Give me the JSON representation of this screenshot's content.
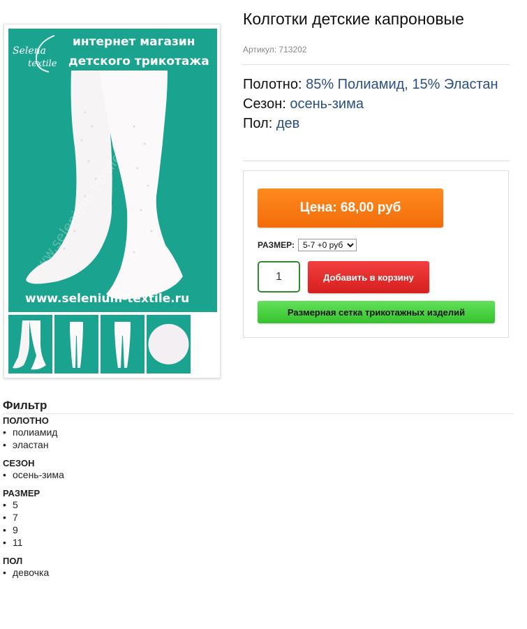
{
  "product": {
    "title": "Колготки детские капроновые",
    "sku_label": "Артикул:",
    "sku_value": "713202",
    "image_banner_line1": "интернет магазин",
    "image_banner_line2": "детского трикотажа",
    "image_logo_line1": "Selena",
    "image_logo_line2": "textile",
    "image_site": "www.selenium-textile.ru",
    "properties": [
      {
        "label": "Полотно:",
        "value": "85% Полиамид, 15% Эластан"
      },
      {
        "label": "Сезон:",
        "value": "осень-зима"
      },
      {
        "label": "Пол:",
        "value": "дев"
      }
    ]
  },
  "buy": {
    "price_label": "Цена: 68,00 руб",
    "size_label": "РАЗМЕР:",
    "size_selected": "5-7 +0 руб",
    "quantity": "1",
    "add_to_cart": "Добавить в корзину",
    "size_chart": "Размерная сетка трикотажных изделий"
  },
  "filter": {
    "title": "Фильтр",
    "groups": [
      {
        "title": "ПОЛОТНО",
        "items": [
          "полиамид",
          "эластан"
        ]
      },
      {
        "title": "СЕЗОН",
        "items": [
          "осень-зима"
        ]
      },
      {
        "title": "РАЗМЕР",
        "items": [
          "5",
          "7",
          "9",
          "11"
        ]
      },
      {
        "title": "ПОЛ",
        "items": [
          "девочка"
        ]
      }
    ]
  },
  "colors": {
    "image_bg": "#1aa38e",
    "price_orange": "#f57a12",
    "cart_red": "#e12e2e",
    "chart_green": "#47cf3e",
    "link_blue": "#2a4f85"
  },
  "icons": {
    "select_arrow": "triangle-down-icon"
  }
}
